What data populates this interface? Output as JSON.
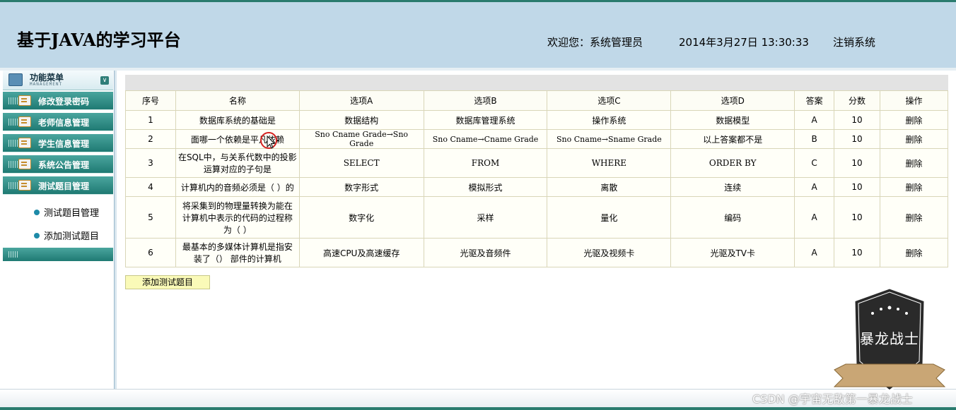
{
  "header": {
    "title": "基于JAVA的学习平台",
    "welcome": "欢迎您：系统管理员",
    "datetime": "2014年3月27日  13:30:33",
    "logout": "注销系统"
  },
  "sidebar": {
    "head_label": "功能菜单",
    "head_sub": "MANAGEMENT",
    "items": [
      {
        "label": "修改登录密码"
      },
      {
        "label": "老师信息管理"
      },
      {
        "label": "学生信息管理"
      },
      {
        "label": "系统公告管理"
      },
      {
        "label": "测试题目管理"
      }
    ],
    "sub_items": [
      {
        "label": "测试题目管理"
      },
      {
        "label": "添加测试题目"
      }
    ]
  },
  "table": {
    "columns": [
      "序号",
      "名称",
      "选项A",
      "选项B",
      "选项C",
      "选项D",
      "答案",
      "分数",
      "操作"
    ],
    "rows": [
      {
        "no": "1",
        "name": "数据库系统的基础是",
        "a": "数据结构",
        "b": "数据库管理系统",
        "c": "操作系统",
        "d": "数据模型",
        "answer": "A",
        "score": "10",
        "action": "删除"
      },
      {
        "no": "2",
        "name": "面哪一个依赖是平凡依赖",
        "a": "Sno Cname Grade→Sno Grade",
        "b": "Sno Cname→Cname Grade",
        "c": "Sno Cname→Sname Grade",
        "d": "以上答案都不是",
        "answer": "B",
        "score": "10",
        "action": "删除"
      },
      {
        "no": "3",
        "name": "在SQL中，与关系代数中的投影运算对应的子句是",
        "a": "SELECT",
        "b": "FROM",
        "c": "WHERE",
        "d": "ORDER BY",
        "answer": "C",
        "score": "10",
        "action": "删除"
      },
      {
        "no": "4",
        "name": "计算机内的音频必须是（ ）的",
        "a": "数字形式",
        "b": "模拟形式",
        "c": "离散",
        "d": "连续",
        "answer": "A",
        "score": "10",
        "action": "删除"
      },
      {
        "no": "5",
        "name": "将采集到的物理量转换为能在计算机中表示的代码的过程称为（ ）",
        "a": "数字化",
        "b": "采样",
        "c": "量化",
        "d": "编码",
        "answer": "A",
        "score": "10",
        "action": "删除"
      },
      {
        "no": "6",
        "name": "最基本的多媒体计算机是指安装了（） 部件的计算机",
        "a": "高速CPU及高速缓存",
        "b": "光驱及音频件",
        "c": "光驱及视频卡",
        "d": "光驱及TV卡",
        "answer": "A",
        "score": "10",
        "action": "删除"
      }
    ]
  },
  "add_button": "添加测试题目",
  "logo_text": "暴龙战士",
  "watermark": "CSDN @宇宙无敌第一暴龙战士",
  "colors": {
    "header_bg": "#c0d8e8",
    "nav_teal": "#1f7a73",
    "accent_line": "#2a7b6e",
    "button_yellow": "#fafab8"
  }
}
